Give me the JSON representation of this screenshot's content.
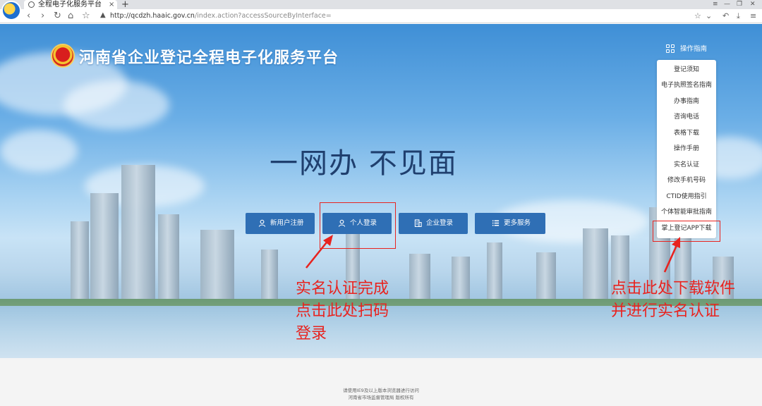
{
  "browser": {
    "tab_title": "全程电子化服务平台",
    "tab_close": "×",
    "new_tab": "+",
    "url_host": "http://qcdzh.haaic.gov.cn",
    "url_path": "/index.action?accessSourceByInterface=",
    "nav": {
      "back": "‹",
      "forward": "›",
      "reload": "↻",
      "home": "⌂",
      "bookmark": "☆"
    },
    "right": {
      "star": "☆",
      "dropdown": "⌄",
      "undo": "↶",
      "download": "⤓",
      "menu": "≡"
    },
    "window": {
      "menu": "≡",
      "minimize": "—",
      "restore": "❐",
      "close": "✕"
    }
  },
  "header": {
    "site_title": "河南省企业登记全程电子化服务平台",
    "guide_label": "操作指南"
  },
  "guide_menu": [
    "登记须知",
    "电子执照签名指南",
    "办事指南",
    "咨询电话",
    "表格下载",
    "操作手册",
    "实名认证",
    "修改手机号码",
    "CTID使用指引",
    "个体智能审批指南",
    "掌上登记APP下载"
  ],
  "slogan": "一网办  不见面",
  "buttons": {
    "register": "新用户注册",
    "personal_login": "个人登录",
    "enterprise_login": "企业登录",
    "more_services": "更多服务"
  },
  "annotations": {
    "left": [
      "实名认证完成",
      "点击此处扫码",
      "登录"
    ],
    "right": [
      "点击此处下载软件",
      "并进行实名认证"
    ],
    "color": "#e8231f"
  },
  "footer": {
    "line1": "请使用IE9及以上版本浏览器进行访问",
    "line2": "河南省市场监督管理局 版权所有"
  },
  "colors": {
    "button_blue": "#2f6fb5",
    "slogan": "#1f3f6e",
    "annotation_red": "#e8231f"
  }
}
